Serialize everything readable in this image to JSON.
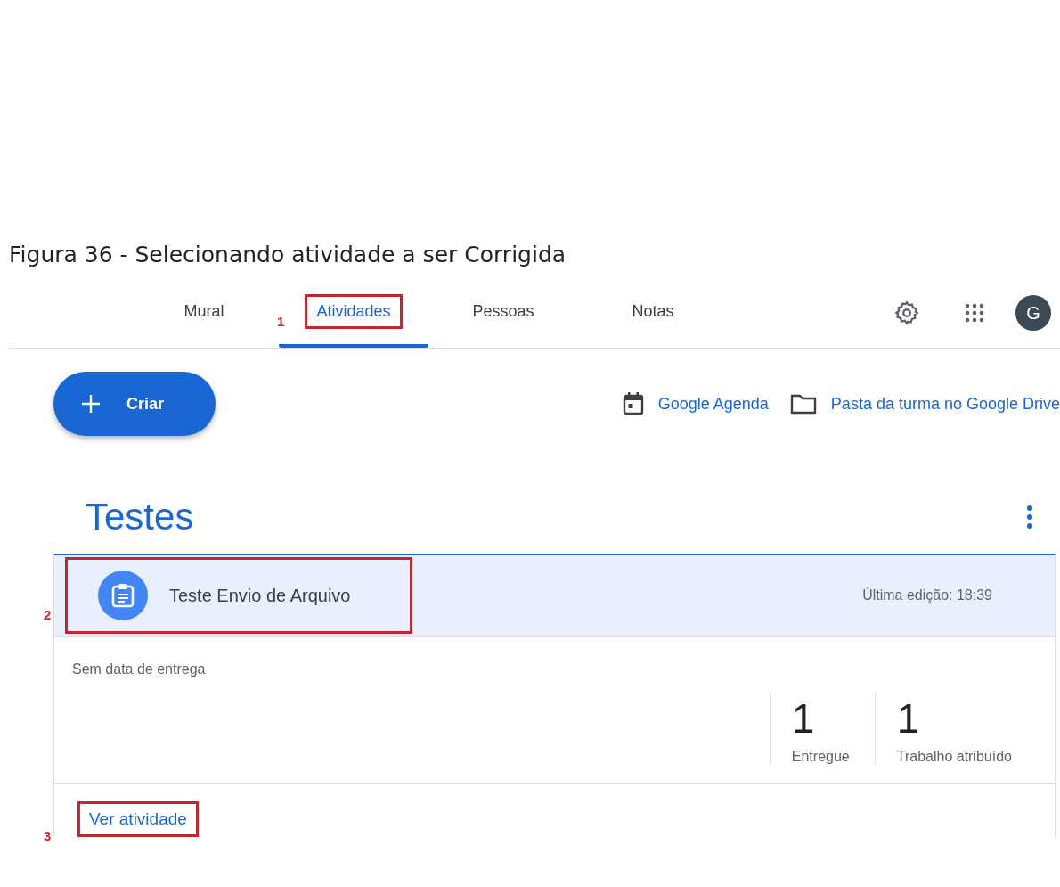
{
  "caption": "Figura 36 - Selecionando atividade a ser Corrigida",
  "tabs": [
    {
      "label": "Mural",
      "selected": false
    },
    {
      "label": "Atividades",
      "selected": true,
      "callout": "1"
    },
    {
      "label": "Pessoas",
      "selected": false
    },
    {
      "label": "Notas",
      "selected": false
    }
  ],
  "avatar": "G",
  "create_button": "Criar",
  "links": [
    {
      "kind": "calendar",
      "label": "Google Agenda"
    },
    {
      "kind": "folder",
      "label": "Pasta da turma no Google Drive"
    }
  ],
  "topic": {
    "title": "Testes",
    "assignment": {
      "title": "Teste Envio de Arquivo",
      "callout": "2",
      "edited": "Última edição: 18:39",
      "due": "Sem data de entrega",
      "stats": [
        {
          "value": "1",
          "label": "Entregue"
        },
        {
          "value": "1",
          "label": "Trabalho atribuído"
        }
      ],
      "view_link": "Ver atividade",
      "view_callout": "3"
    }
  }
}
